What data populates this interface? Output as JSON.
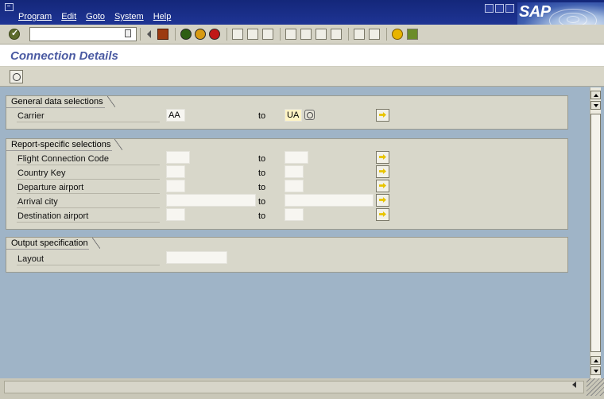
{
  "menubar": {
    "items": [
      "Program",
      "Edit",
      "Goto",
      "System",
      "Help"
    ],
    "logo_text": "SAP"
  },
  "toolbar": {
    "command_field_value": "",
    "icons": [
      "enter-icon",
      "command-field-menu-icon",
      "back-arrow-icon",
      "save-icon",
      "back-icon",
      "exit-icon",
      "cancel-icon",
      "print-icon",
      "find-icon",
      "find-next-icon",
      "first-page-icon",
      "previous-page-icon",
      "next-page-icon",
      "last-page-icon",
      "create-session-icon",
      "shortcut-icon",
      "help-icon",
      "layout-menu-icon"
    ]
  },
  "title": "Connection Details",
  "app_toolbar": {
    "icons": [
      "execute-icon"
    ]
  },
  "groups": {
    "general": {
      "title": "General data selections",
      "rows": [
        {
          "label": "Carrier",
          "from": "AA",
          "to_label": "to",
          "to": "UA"
        }
      ]
    },
    "report": {
      "title": "Report-specific selections",
      "rows": [
        {
          "label": "Flight Connection Code",
          "from": "",
          "to_label": "to",
          "to": ""
        },
        {
          "label": "Country Key",
          "from": "",
          "to_label": "to",
          "to": ""
        },
        {
          "label": "Departure airport",
          "from": "",
          "to_label": "to",
          "to": ""
        },
        {
          "label": "Arrival city",
          "from": "",
          "to_label": "to",
          "to": ""
        },
        {
          "label": "Destination airport",
          "from": "",
          "to_label": "to",
          "to": ""
        }
      ]
    },
    "output": {
      "title": "Output specification",
      "rows": [
        {
          "label": "Layout",
          "value": ""
        }
      ]
    }
  },
  "colors": {
    "menubar": "#1e3494",
    "title_text": "#4a5aa2",
    "work_area": "#9fb4c7",
    "group_bg": "#d8d7ca",
    "highlight_field": "#fff4c4"
  }
}
